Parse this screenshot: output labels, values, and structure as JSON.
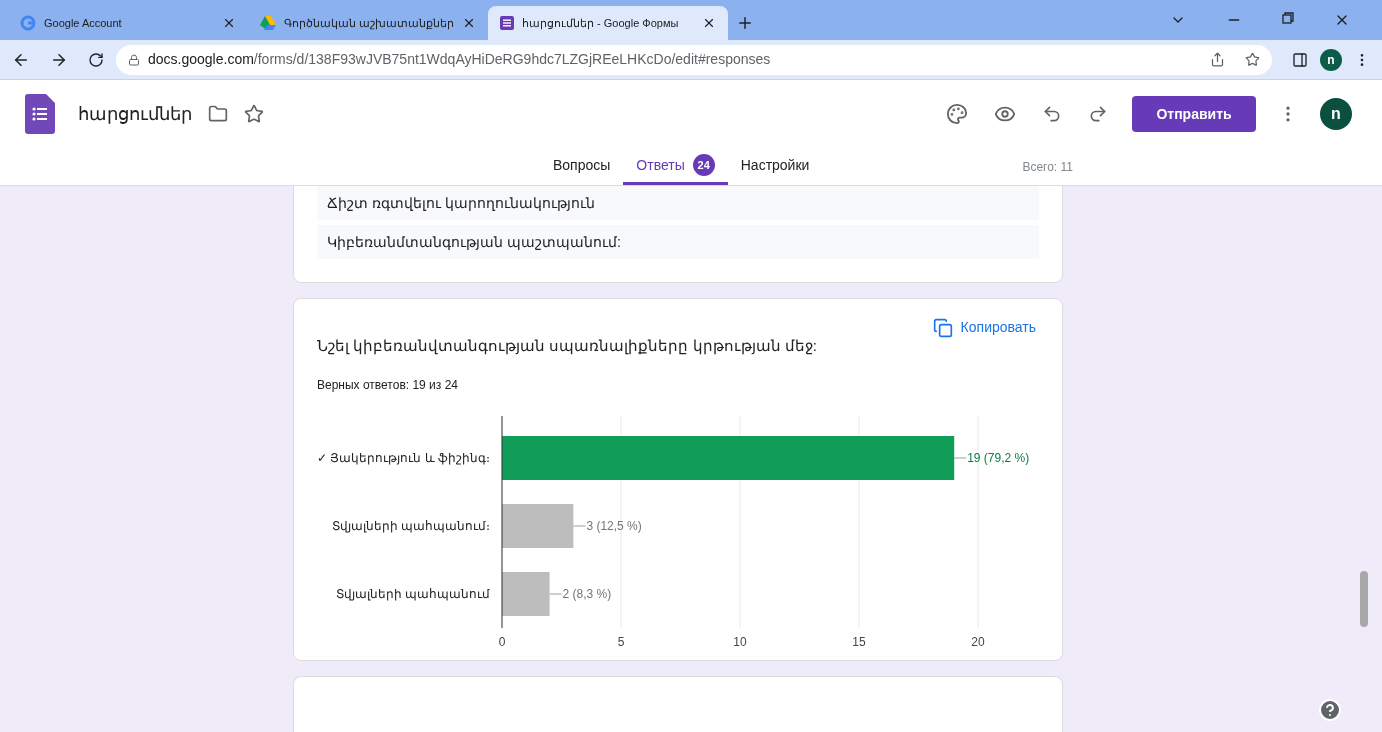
{
  "browser": {
    "tabs": [
      {
        "title": "Google Account",
        "selected": false
      },
      {
        "title": "Գործնական աշխատանքներ",
        "selected": false
      },
      {
        "title": "հարցումներ - Google Формы",
        "selected": true
      }
    ],
    "url": {
      "host": "docs.google.com",
      "path": "/forms/d/138F93wJVB75nt1WdqAyHiDeRG9hdc7LZGjREeLHKcDo/edit#responses"
    },
    "profile_initial": "n"
  },
  "header": {
    "title": "հարցումներ",
    "send_button": "Отправить",
    "avatar_initial": "n",
    "tabs": [
      {
        "label": "Вопросы",
        "selected": false
      },
      {
        "label": "Ответы",
        "selected": true,
        "badge": "24"
      },
      {
        "label": "Настройки",
        "selected": false
      }
    ],
    "total": "Всего: 11"
  },
  "previous_card": {
    "options": [
      "Ճիշտ ռգտվելու կարողունակություն",
      "Կիբեռանմտանգության պաշտպանում:"
    ]
  },
  "question_card": {
    "copy_button": "Копировать",
    "question": "Նշել կիբեռանվտանգության սպառնալիքները կրթության մեջ:",
    "score": "Верных ответов: 19 из 24",
    "chart_data": {
      "type": "bar",
      "orientation": "horizontal",
      "stacked": true,
      "grid": true,
      "categories": [
        "✓ Յակերություն և ֆիշինգ։",
        "Տվյալների պահպանում։",
        "Տվյալների պահպանում"
      ],
      "series": [
        {
          "color": "#0f9d58",
          "values": [
            19,
            null,
            null
          ]
        },
        {
          "color": "#bdbdbd",
          "values": [
            null,
            3,
            2
          ]
        }
      ],
      "xlim": [
        0,
        20
      ],
      "xticks": [
        0,
        5,
        10,
        15,
        20
      ],
      "value_labels": [
        "19 (79,2 %)",
        "3 (12,5 %)",
        "2 (8,3 %)"
      ]
    }
  }
}
